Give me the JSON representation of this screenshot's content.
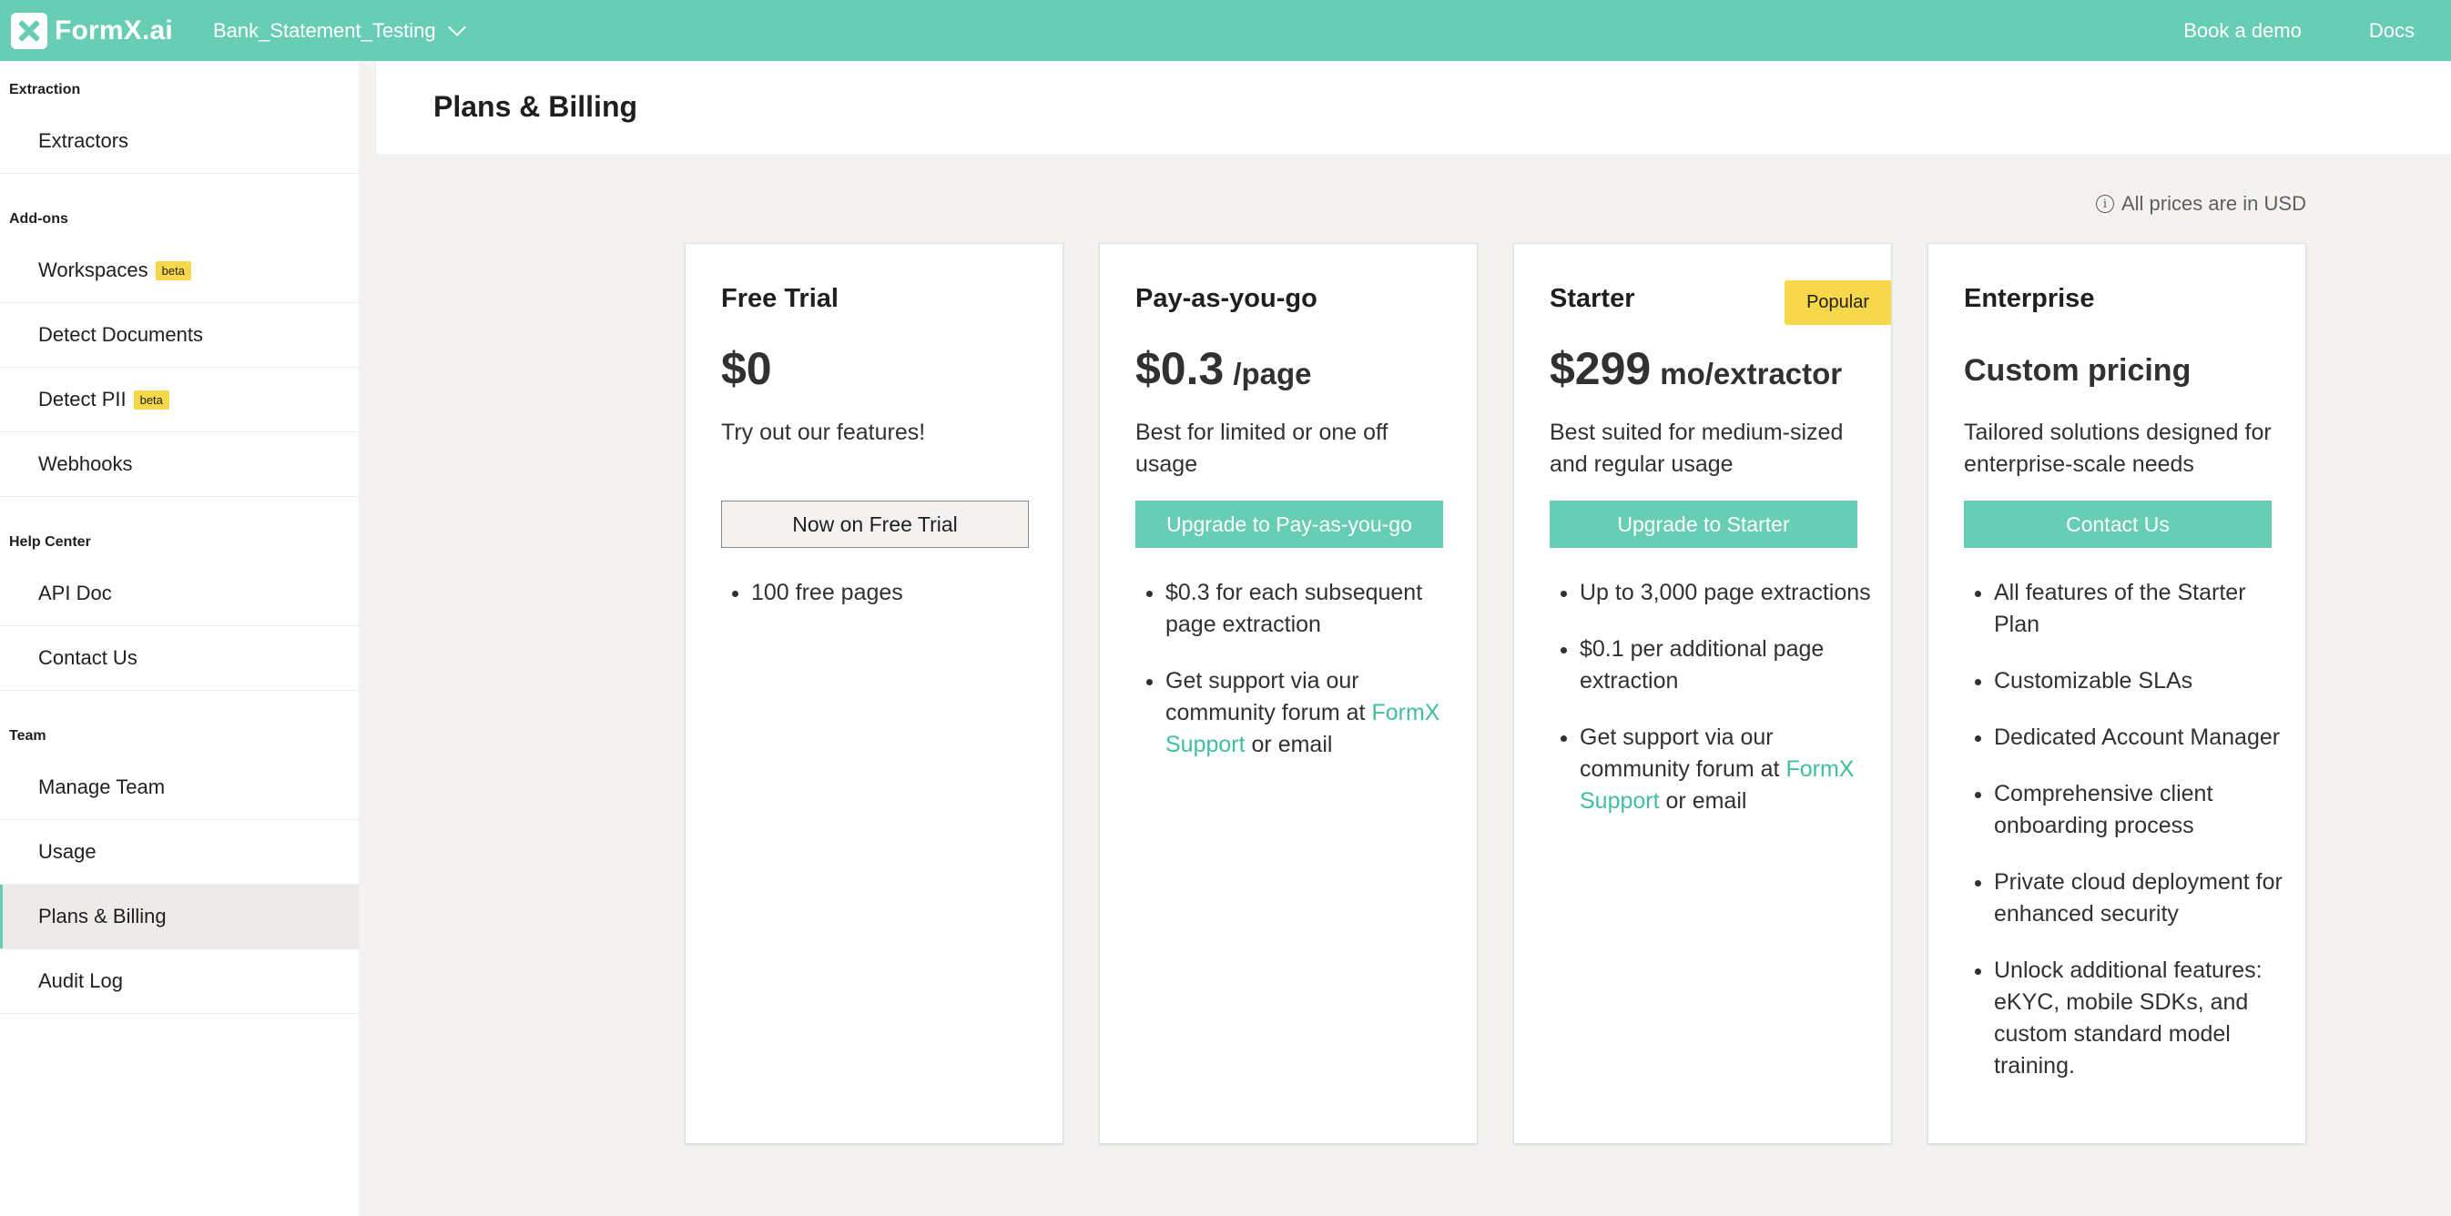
{
  "topbar": {
    "logo_text": "FormX.ai",
    "workspace": "Bank_Statement_Testing",
    "book_demo": "Book a demo",
    "docs": "Docs"
  },
  "sidebar": {
    "sections": [
      {
        "title": "Extraction",
        "items": [
          {
            "label": "Extractors"
          }
        ]
      },
      {
        "title": "Add-ons",
        "items": [
          {
            "label": "Workspaces",
            "badge": "beta"
          },
          {
            "label": "Detect Documents"
          },
          {
            "label": "Detect PII",
            "badge": "beta"
          },
          {
            "label": "Webhooks"
          }
        ]
      },
      {
        "title": "Help Center",
        "items": [
          {
            "label": "API Doc"
          },
          {
            "label": "Contact Us"
          }
        ]
      },
      {
        "title": "Team",
        "items": [
          {
            "label": "Manage Team"
          },
          {
            "label": "Usage"
          },
          {
            "label": "Plans & Billing",
            "active": true
          },
          {
            "label": "Audit Log"
          }
        ]
      }
    ]
  },
  "main": {
    "title": "Plans & Billing",
    "price_note": "All prices are in USD",
    "plans": [
      {
        "name": "Free Trial",
        "price": "$0",
        "description": "Try out our features!",
        "cta": "Now on Free Trial",
        "features": [
          "100 free pages"
        ]
      },
      {
        "name": "Pay-as-you-go",
        "price": "$0.3",
        "price_unit": "/page",
        "description": "Best for limited or one off usage",
        "cta": "Upgrade to Pay-as-you-go",
        "features": [
          "$0.3 for each subsequent page extraction"
        ],
        "support_prefix": "Get support via our community forum at",
        "support_link": "FormX Support",
        "support_suffix": "or email"
      },
      {
        "name": "Starter",
        "badge": "Popular",
        "price": "$299",
        "price_unit": "mo/extractor",
        "description": "Best suited for medium-sized and regular usage",
        "cta": "Upgrade to Starter",
        "features": [
          "Up to 3,000 page extractions",
          "$0.1 per additional page extraction"
        ],
        "support_prefix": "Get support via our community forum at",
        "support_link": "FormX Support",
        "support_suffix": "or email"
      },
      {
        "name": "Enterprise",
        "price": "Custom pricing",
        "description": "Tailored solutions designed for enterprise-scale needs",
        "cta": "Contact Us",
        "features": [
          "All features of the Starter Plan",
          "Customizable SLAs",
          "Dedicated Account Manager",
          "Comprehensive client onboarding process",
          "Private cloud deployment for enhanced security",
          "Unlock additional features: eKYC, mobile SDKs, and custom standard model training."
        ]
      }
    ]
  },
  "colors": {
    "brand": "#67cdb4",
    "badge": "#f7d84a",
    "link": "#3fbf9f"
  }
}
